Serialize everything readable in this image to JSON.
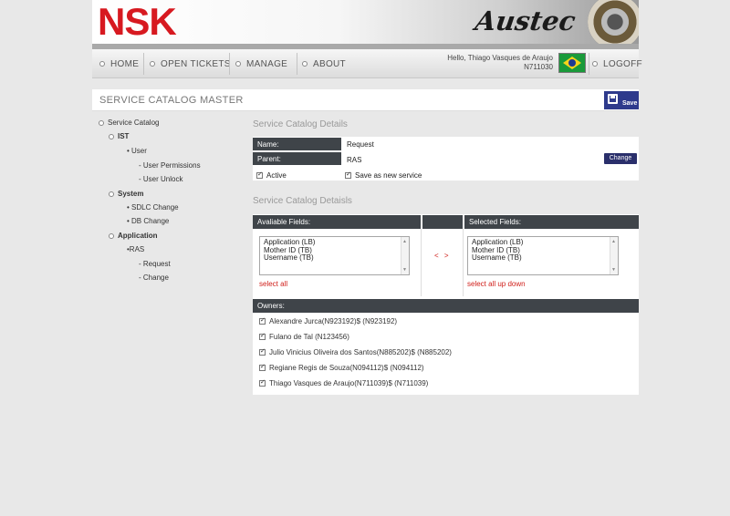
{
  "header": {
    "logo": "NSK",
    "brand": "Austec"
  },
  "nav": {
    "items": [
      "HOME",
      "OPEN TICKETS",
      "MANAGE",
      "ABOUT"
    ],
    "greeting": "Hello, Thiago Vasques de Araujo",
    "user_id": "N711030",
    "logoff": "LOGOFF",
    "flag_icon": "brazil-flag-icon"
  },
  "page": {
    "title": "SERVICE CATALOG MASTER",
    "save_label": "Save"
  },
  "tree": {
    "root": "Service Catalog",
    "ist": "IST",
    "user": "• User",
    "user_permissions": "- User Permissions",
    "user_unlock": "- User Unlock",
    "system": "System",
    "sdlc_change": "• SDLC Change",
    "db_change": "• DB Change",
    "application": "Application",
    "ras": "•RAS",
    "request": "- Request",
    "change": "- Change"
  },
  "details": {
    "section_title": "Service Catalog Details",
    "name_label": "Name:",
    "name_value": "Request",
    "parent_label": "Parent:",
    "parent_value": "RAS",
    "change_button": "Change",
    "active_label": "Active",
    "active_checked": true,
    "save_as_new_label": "Save as new service",
    "save_as_new_checked": true
  },
  "fields": {
    "section_title": "Service Catalog Detaisls",
    "available_header": "Avaliable Fields:",
    "selected_header": "Selected Fields:",
    "available": [
      "Application (LB)",
      "Mother ID (TB)",
      "Username (TB)"
    ],
    "selected": [
      "Application (LB)",
      "Mother ID (TB)",
      "Username (TB)"
    ],
    "move_left": "<",
    "move_right": ">",
    "select_all": "select all",
    "select_all_up_down": "select all up down"
  },
  "owners": {
    "header": "Owners:",
    "list": [
      "Alexandre Jurca(N923192)$ (N923192)",
      "Fulano de Tal (N123456)",
      "Julio Vinicius Oliveira dos Santos(N885202)$ (N885202)",
      "Regiane Regis de Souza(N094112)$ (N094112)",
      "Thiago Vasques de Araujo(N711039)$ (N711039)"
    ]
  },
  "colors": {
    "logo_red": "#d71920",
    "dark_row": "#3f4449",
    "save_blue": "#2e3a8c",
    "link_red": "#d0211c"
  }
}
